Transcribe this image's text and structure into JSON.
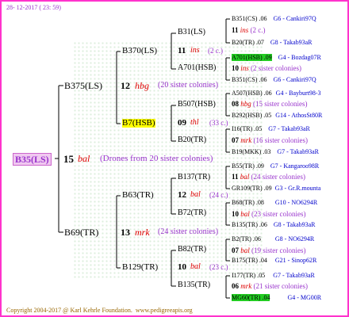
{
  "header": {
    "date": "28- 12-2017 ( 23: 59)"
  },
  "footer": {
    "copyright": "Copyright 2004-2017 @ Karl Kehrle Foundation.",
    "site": "www.pedigreeapis.org"
  },
  "colors": {
    "border": "#ff33cc",
    "purple": "#9933cc",
    "blue": "#0000cc",
    "red": "#dd0000",
    "highlight_green": "#22cc22",
    "highlight_yellow": "#ffff00",
    "root_bg": "#f0c8f0"
  },
  "root": {
    "id": "B35(LS)",
    "num": "15",
    "mark": "bal",
    "note": "(Drones from 20 sister colonies)"
  },
  "gen1": [
    {
      "id": "B375(LS)",
      "num": "12",
      "mark": "hbg",
      "note": "(20 sister colonies)"
    },
    {
      "id": "B69(TR)",
      "num": "13",
      "mark": "mrk",
      "note": "(24 sister colonies)"
    }
  ],
  "gen2": [
    {
      "id": "B370(LS)",
      "num": "11",
      "mark": "ins",
      "note": "(2 c.)"
    },
    {
      "id": "B7(HSB)",
      "num": "09",
      "mark": "thl",
      "note": "(33 c.)"
    },
    {
      "id": "B63(TR)",
      "num": "12",
      "mark": "bal",
      "note": "(24 c.)"
    },
    {
      "id": "B129(TR)",
      "num": "10",
      "mark": "bal",
      "note": "(23 c.)"
    }
  ],
  "gen3": [
    {
      "id": "B31(LS)",
      "num": "11",
      "mark": "ins",
      "note": "(2 c.)"
    },
    {
      "id": "A701(HSB)",
      "num": "10",
      "mark": "ins",
      "note": "(2 sister colonies)"
    },
    {
      "id": "B507(HSB)",
      "num": "08",
      "mark": "hbg",
      "note": "(15 sister colonies)"
    },
    {
      "id": "B20(TR)",
      "num": "07",
      "mark": "mrk",
      "note": "(16 sister colonies)"
    },
    {
      "id": "B137(TR)",
      "num": "11",
      "mark": "bal",
      "note": "(24 sister colonies)"
    },
    {
      "id": "B72(TR)",
      "num": "10",
      "mark": "bal",
      "note": "(23 sister colonies)"
    },
    {
      "id": "B82(TR)",
      "num": "07",
      "mark": "bal",
      "note": "(19 sister colonies)"
    },
    {
      "id": "B135(TR)",
      "num": "06",
      "mark": "mrk",
      "note": "(21 sister colonies)"
    }
  ],
  "gen4": [
    {
      "id": "B351(CS)",
      "val": ".06",
      "ref": "G6 - Cankiri97Q"
    },
    {
      "id": "B20(TR)",
      "val": ".07",
      "ref": "G8 - Takab93aR"
    },
    {
      "id": "A701(HSB)",
      "val": ".09",
      "ref": "G4 - Bozdag07R"
    },
    {
      "id": "B351(CS)",
      "val": ".06",
      "ref": "G6 - Cankiri97Q"
    },
    {
      "id": "A507(HSB)",
      "val": ".06",
      "ref": "G4 - Bayburt98-3"
    },
    {
      "id": "B292(HSB)",
      "val": ".05",
      "ref": "G14 - AthosSt80R"
    },
    {
      "id": "I16(TR)",
      "val": ".05",
      "ref": "G7 - Takab93aR"
    },
    {
      "id": "B19(MKK)",
      "val": ".03",
      "ref": "G7 - Takab93aR"
    },
    {
      "id": "B55(TR)",
      "val": ".09",
      "ref": "G7 - Kangaroo98R"
    },
    {
      "id": "GR109(TR)",
      "val": ".09",
      "ref": "G3 - Gr.R.mounta"
    },
    {
      "id": "B68(TR)",
      "val": ".08",
      "ref": "G10 - NO6294R"
    },
    {
      "id": "B135(TR)",
      "val": ".06",
      "ref": "G8 - Takab93aR"
    },
    {
      "id": "B2(TR)",
      "val": ".06",
      "ref": "G8 - NO6294R"
    },
    {
      "id": "B175(TR)",
      "val": ".04",
      "ref": "G21 - Sinop62R"
    },
    {
      "id": "I177(TR)",
      "val": ".05",
      "ref": "G7 - Takab93aR"
    },
    {
      "id": "MG60(TR)",
      "val": ".04",
      "ref": "G4 - MG00R"
    }
  ]
}
